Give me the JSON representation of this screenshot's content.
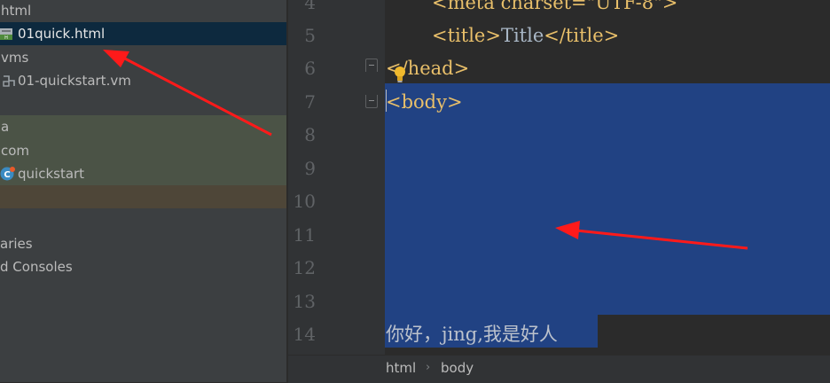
{
  "project_tree": {
    "items": [
      {
        "label": "html"
      },
      {
        "label": "01quick.html",
        "icon": "html-file-icon",
        "selected": true
      },
      {
        "label": "vms"
      },
      {
        "label": "01-quickstart.vm",
        "icon": "vm-template-icon"
      },
      {
        "label": "a"
      },
      {
        "label": "com"
      },
      {
        "label": "quickstart",
        "icon": "java-class-icon"
      },
      {
        "label": "aries"
      },
      {
        "label": "d Consoles"
      }
    ]
  },
  "editor": {
    "line_numbers": [
      "4",
      "5",
      "6",
      "7",
      "8",
      "9",
      "10",
      "11",
      "12",
      "13",
      "14"
    ],
    "lines": {
      "line4": "<meta charset=\"UTF-8\">",
      "line5_open": "<title>",
      "line5_text": "Title",
      "line5_close": "</title>",
      "line6": "</head>",
      "line7": "<body>",
      "line14": "你好，jing,我是好人"
    }
  },
  "breadcrumb": {
    "items": [
      "html",
      "body"
    ],
    "separator": "›"
  },
  "colors": {
    "tree_bg": "#3c3f41",
    "editor_bg": "#2b2b2b",
    "selection": "#214283",
    "tag": "#e8bf6a",
    "annotation_arrow": "#ff1a1a"
  }
}
